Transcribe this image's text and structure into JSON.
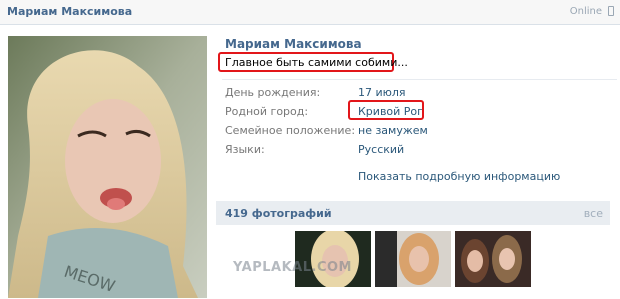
{
  "header": {
    "name": "Мариам Максимова",
    "online": "Online"
  },
  "profile": {
    "full_name": "Мариам Максимова",
    "status": "Главное быть самими собими..."
  },
  "info": [
    {
      "label": "День рождения:",
      "value": "17 июля"
    },
    {
      "label": "Родной город:",
      "value": "Кривой Рог"
    },
    {
      "label": "Семейное положение:",
      "value": "не замужем"
    },
    {
      "label": "Языки:",
      "value": "Русский"
    }
  ],
  "more_link": "Показать подробную информацию",
  "photos": {
    "title": "419 фотографий",
    "all": "все"
  },
  "watermark": "YAPLAKAL.COM",
  "colors": {
    "link": "#2b587a",
    "header_blue": "#45688e",
    "highlight_red": "#e2161a"
  }
}
